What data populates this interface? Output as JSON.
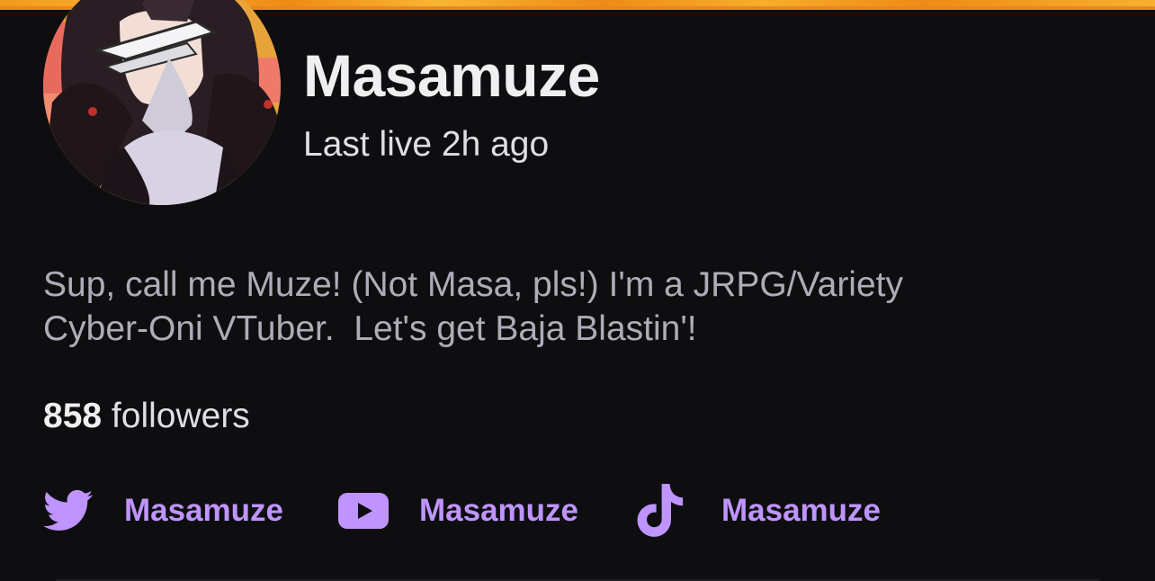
{
  "channel": {
    "name": "Masamuze",
    "last_live": "Last live 2h ago",
    "bio_line1": "Sup, call me Muze! (Not Masa, pls!) I'm a JRPG/Variety",
    "bio_line2": "Cyber-Oni VTuber.  Let's get Baja Blastin'!",
    "followers_count": "858",
    "followers_label": "followers"
  },
  "socials": [
    {
      "icon": "twitter-icon",
      "label": "Masamuze"
    },
    {
      "icon": "youtube-icon",
      "label": "Masamuze"
    },
    {
      "icon": "tiktok-icon",
      "label": "Masamuze"
    }
  ],
  "colors": {
    "background": "#0e0e10",
    "accent": "#bf94ff",
    "top_strip": "#f39a1c"
  }
}
